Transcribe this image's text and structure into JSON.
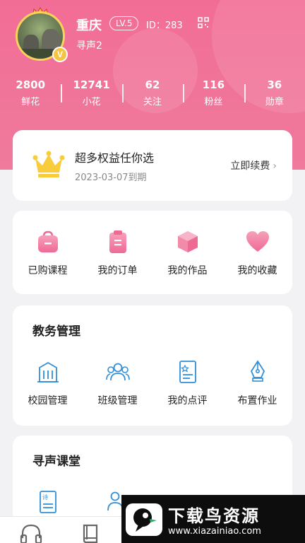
{
  "profile": {
    "name": "重庆",
    "level": "LV.5",
    "id_text": "ID：283",
    "subtitle": "寻声2",
    "badge": "V"
  },
  "stats": [
    {
      "value": "2800",
      "label": "鲜花"
    },
    {
      "value": "12741",
      "label": "小花"
    },
    {
      "value": "62",
      "label": "关注"
    },
    {
      "value": "116",
      "label": "粉丝"
    },
    {
      "value": "36",
      "label": "勋章"
    }
  ],
  "vip": {
    "title": "超多权益任你选",
    "expire": "2023-03-07到期",
    "renew_label": "立即续费",
    "chevron": "›"
  },
  "quick_links": [
    {
      "label": "已购课程",
      "icon": "bag-icon"
    },
    {
      "label": "我的订单",
      "icon": "clipboard-icon"
    },
    {
      "label": "我的作品",
      "icon": "cube-icon"
    },
    {
      "label": "我的收藏",
      "icon": "heart-icon"
    }
  ],
  "edu": {
    "title": "教务管理",
    "items": [
      {
        "label": "校园管理",
        "icon": "building-icon"
      },
      {
        "label": "班级管理",
        "icon": "group-icon"
      },
      {
        "label": "我的点评",
        "icon": "review-doc-icon"
      },
      {
        "label": "布置作业",
        "icon": "pen-nib-icon"
      }
    ]
  },
  "classroom": {
    "title": "寻声课堂",
    "items": [
      {
        "label": "",
        "icon": "poem-doc-icon",
        "icon_text": "诗"
      },
      {
        "label": "",
        "icon": "person-icon"
      }
    ]
  },
  "bottom_nav": [
    {
      "icon": "headphones-icon"
    },
    {
      "icon": "book-icon"
    }
  ],
  "watermark": {
    "title": "下载鸟资源",
    "url": "www.xiazainiao.com"
  },
  "colors": {
    "header_pink": "#f26d96",
    "icon_pink": "#f0709a",
    "icon_blue": "#2f8fd8",
    "crown_gold": "#f8cc3a"
  }
}
